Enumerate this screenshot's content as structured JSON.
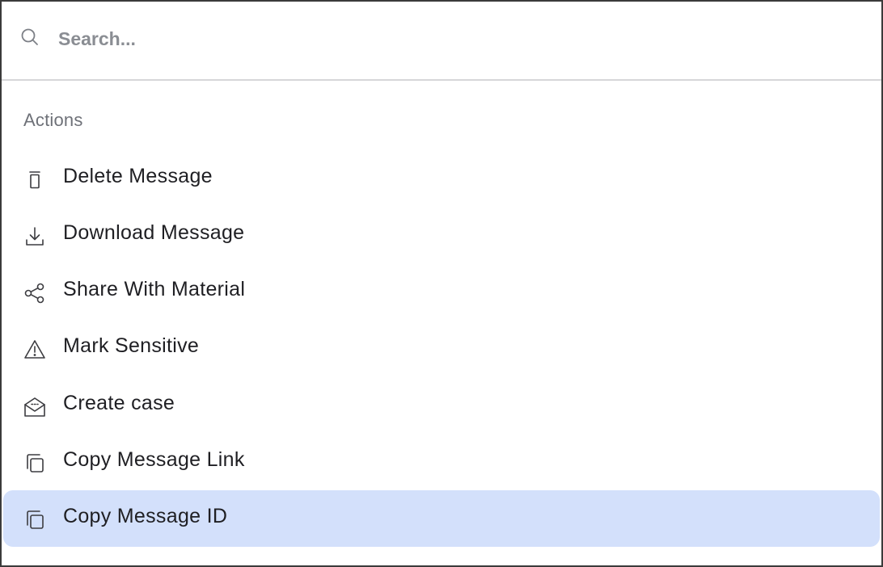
{
  "search": {
    "placeholder": "Search..."
  },
  "sections": [
    {
      "label": "Actions",
      "items": [
        {
          "label": "Delete Message",
          "icon": "trash-icon"
        },
        {
          "label": "Download Message",
          "icon": "download-icon"
        },
        {
          "label": "Share With Material",
          "icon": "share-icon"
        },
        {
          "label": "Mark Sensitive",
          "icon": "warning-icon"
        },
        {
          "label": "Create case",
          "icon": "open-envelope-icon"
        },
        {
          "label": "Copy Message Link",
          "icon": "copy-icon"
        },
        {
          "label": "Copy Message ID",
          "icon": "copy-icon",
          "selected": true
        }
      ]
    }
  ],
  "colors": {
    "selected_bg": "#d3e0fb",
    "border": "#3b3b3b",
    "divider": "#d6d6d9",
    "section_label": "#6e7178",
    "text": "#1f1f23"
  }
}
